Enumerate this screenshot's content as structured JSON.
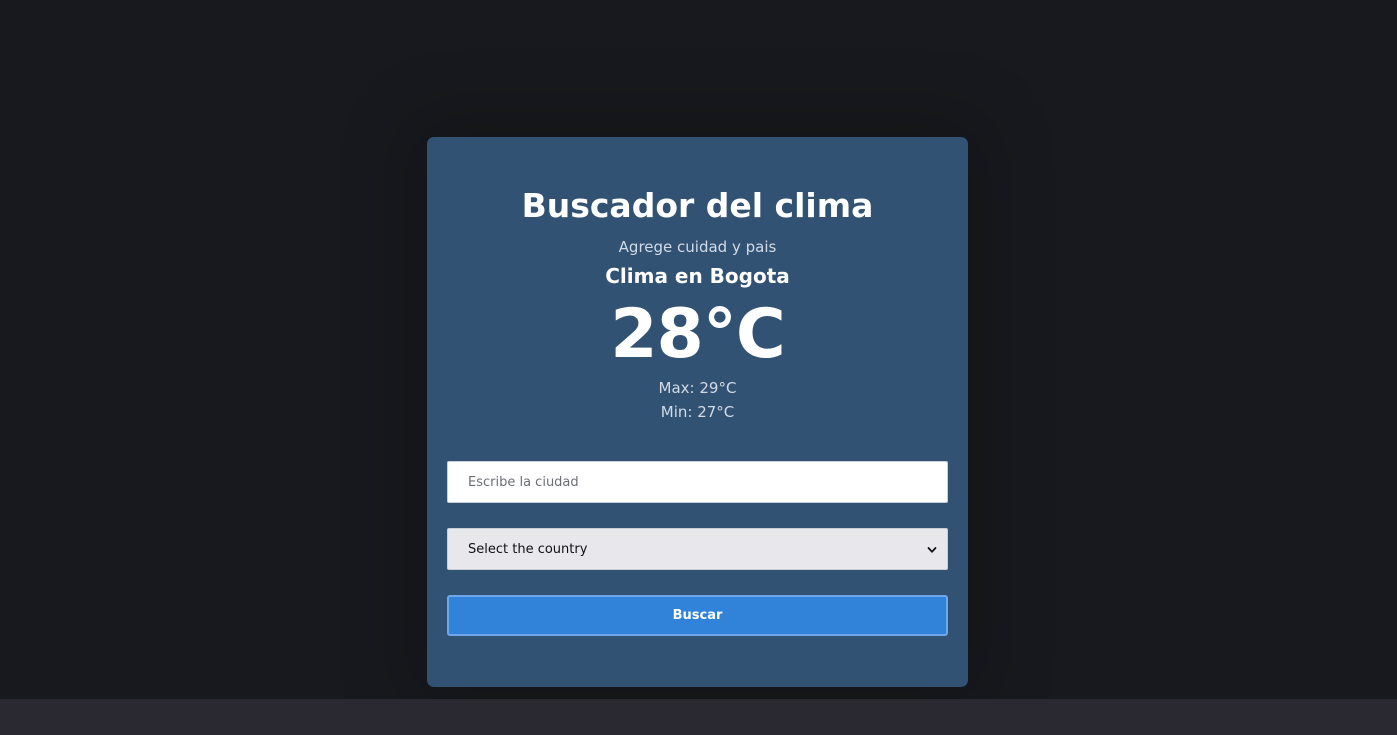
{
  "app": {
    "title": "Buscador del clima",
    "subtitle": "Agrege cuidad y pais"
  },
  "weather": {
    "heading": "Clima en Bogota",
    "temperature": "28°C",
    "max": "Max: 29°C",
    "min": "Min: 27°C"
  },
  "form": {
    "city_placeholder": "Escribe la ciudad",
    "city_value": "",
    "country_selected": "Select the country",
    "submit_label": "Buscar"
  },
  "colors": {
    "background": "#17191e",
    "card": "#325274",
    "button": "#3183d9",
    "bottom_bar": "#2a2830"
  }
}
